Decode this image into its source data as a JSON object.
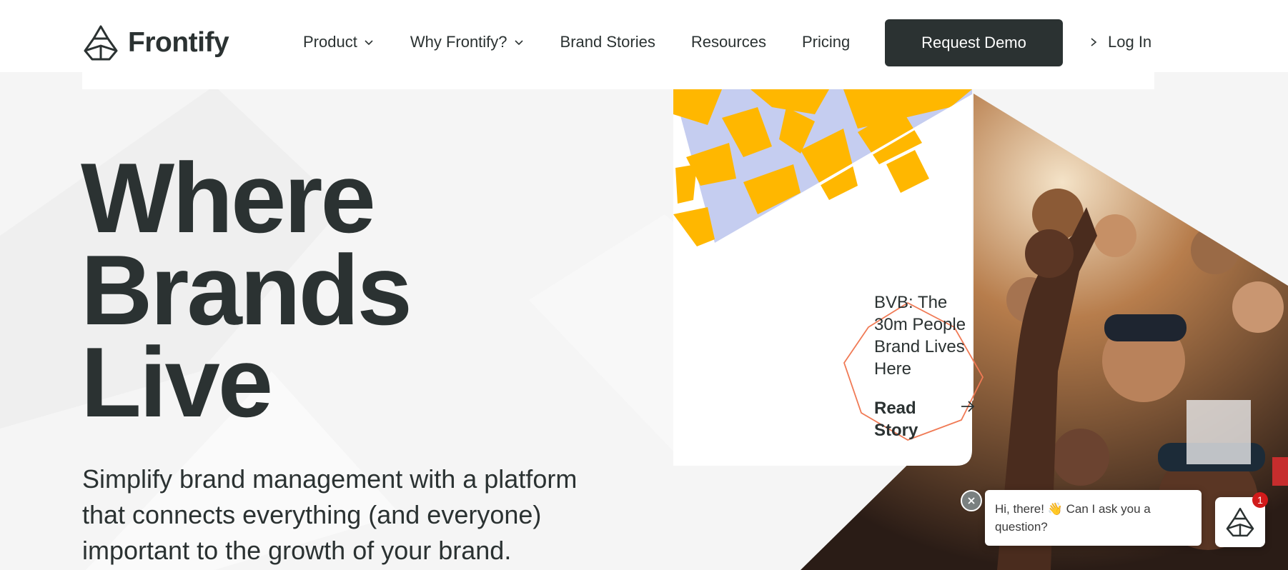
{
  "brand": {
    "name": "Frontify"
  },
  "nav": {
    "items": [
      {
        "label": "Product",
        "has_dropdown": true
      },
      {
        "label": "Why Frontify?",
        "has_dropdown": true
      },
      {
        "label": "Brand Stories",
        "has_dropdown": false
      },
      {
        "label": "Resources",
        "has_dropdown": false
      },
      {
        "label": "Pricing",
        "has_dropdown": false
      }
    ],
    "demo_label": "Request Demo",
    "login_label": "Log In"
  },
  "hero": {
    "title_lines": [
      "Where",
      "Brands",
      "Live"
    ],
    "subtitle_lines": [
      "Simplify brand management with a platform",
      "that connects everything (and everyone)",
      "important to the growth of your brand."
    ]
  },
  "story": {
    "title_lines": [
      "BVB: The",
      "30m People",
      "Brand Lives",
      "Here"
    ],
    "read_lines": [
      "Read",
      "Story"
    ]
  },
  "chat": {
    "message_lines": [
      "Hi, there! 👋 Can I ask you a",
      "question?"
    ],
    "badge": "1"
  },
  "colors": {
    "dark": "#2b3232",
    "accent_yellow": "#ffb700",
    "accent_lavender": "#c5cdf0",
    "doodle_orange": "#f07a55",
    "badge_red": "#d11b1b"
  },
  "icons": [
    "frontify-logo-icon",
    "chevron-down-icon",
    "chevron-right-icon",
    "arrow-right-icon",
    "close-icon"
  ]
}
